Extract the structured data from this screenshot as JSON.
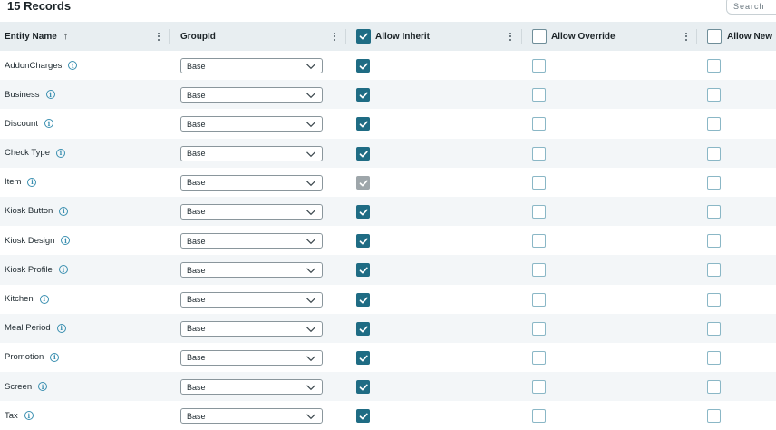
{
  "header": {
    "records_label": "15 Records"
  },
  "search": {
    "placeholder": "Search"
  },
  "columns": {
    "entity_name": "Entity Name",
    "group_id": "GroupId",
    "allow_inherit": "Allow Inherit",
    "allow_override": "Allow Override",
    "allow_new": "Allow New"
  },
  "header_checkboxes": {
    "allow_inherit": true,
    "allow_override": false,
    "allow_new": false
  },
  "rows": [
    {
      "name": "AddonCharges",
      "group": "Base",
      "allow_inherit": "checked",
      "allow_override": false,
      "allow_new": false
    },
    {
      "name": "Business",
      "group": "Base",
      "allow_inherit": "checked",
      "allow_override": false,
      "allow_new": false
    },
    {
      "name": "Discount",
      "group": "Base",
      "allow_inherit": "checked",
      "allow_override": false,
      "allow_new": false
    },
    {
      "name": "Check Type",
      "group": "Base",
      "allow_inherit": "checked",
      "allow_override": false,
      "allow_new": false
    },
    {
      "name": "Item",
      "group": "Base",
      "allow_inherit": "checked-disabled",
      "allow_override": false,
      "allow_new": false
    },
    {
      "name": "Kiosk Button",
      "group": "Base",
      "allow_inherit": "checked",
      "allow_override": false,
      "allow_new": false
    },
    {
      "name": "Kiosk Design",
      "group": "Base",
      "allow_inherit": "checked",
      "allow_override": false,
      "allow_new": false
    },
    {
      "name": "Kiosk Profile",
      "group": "Base",
      "allow_inherit": "checked",
      "allow_override": false,
      "allow_new": false
    },
    {
      "name": "Kitchen",
      "group": "Base",
      "allow_inherit": "checked",
      "allow_override": false,
      "allow_new": false
    },
    {
      "name": "Meal Period",
      "group": "Base",
      "allow_inherit": "checked",
      "allow_override": false,
      "allow_new": false
    },
    {
      "name": "Promotion",
      "group": "Base",
      "allow_inherit": "checked",
      "allow_override": false,
      "allow_new": false
    },
    {
      "name": "Screen",
      "group": "Base",
      "allow_inherit": "checked",
      "allow_override": false,
      "allow_new": false
    },
    {
      "name": "Tax",
      "group": "Base",
      "allow_inherit": "checked",
      "allow_override": false,
      "allow_new": false
    }
  ],
  "icons": {
    "sort": "arrow-up-icon",
    "info": "info-circle-icon",
    "dropdown": "chevron-down-icon",
    "column_menu": "kebab-menu-icon",
    "check": "checkmark-icon"
  },
  "colors": {
    "header_bg": "#e8eef1",
    "checked": "#1f6c84",
    "checked_disabled": "#9ea6aa",
    "unchecked_border": "#8ab7c6",
    "info_accent": "#3a8fb0",
    "alt_row_bg": "#f3f6f8"
  }
}
